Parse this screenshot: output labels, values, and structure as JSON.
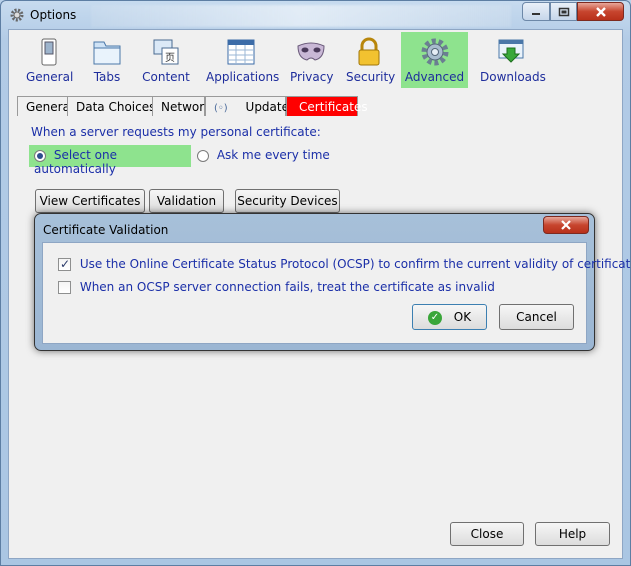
{
  "window": {
    "title": "Options"
  },
  "toolbar": {
    "items": [
      {
        "label": "General",
        "icon": "switch-icon"
      },
      {
        "label": "Tabs",
        "icon": "tabs-icon"
      },
      {
        "label": "Content",
        "icon": "content-icon"
      },
      {
        "label": "Applications",
        "icon": "applications-icon"
      },
      {
        "label": "Privacy",
        "icon": "privacy-mask-icon"
      },
      {
        "label": "Security",
        "icon": "padlock-icon"
      },
      {
        "label": "Advanced",
        "icon": "gear-icon",
        "selected": true
      },
      {
        "label": "Downloads",
        "icon": "downloads-icon"
      }
    ]
  },
  "subtabs": {
    "items": [
      {
        "label": "General"
      },
      {
        "label": "Data Choices"
      },
      {
        "label": "Network"
      },
      {
        "label": "Update"
      },
      {
        "label": "Certificates",
        "selected": true
      }
    ]
  },
  "certificates": {
    "prompt": "When a server requests my personal certificate:",
    "radio_auto": "Select one automatically",
    "radio_ask": "Ask me every time",
    "selected_option": "Select one automatically",
    "btn_view": "View Certificates",
    "btn_validation": "Validation",
    "btn_devices": "Security Devices"
  },
  "dialog": {
    "title": "Certificate Validation",
    "ocsp_label": "Use the Online Certificate Status Protocol (OCSP) to confirm the current validity of certificates",
    "ocsp_checked": true,
    "fail_label": "When an OCSP server connection fails, treat the certificate as invalid",
    "fail_checked": false,
    "ok_label": "OK",
    "cancel_label": "Cancel"
  },
  "footer": {
    "close_label": "Close",
    "help_label": "Help"
  },
  "colors": {
    "accent_text": "#1b2fa8",
    "selected_tab": "#ff0000",
    "selected_toolbar": "#8ee38e",
    "auto_radio_highlight": "#8ee38e"
  }
}
